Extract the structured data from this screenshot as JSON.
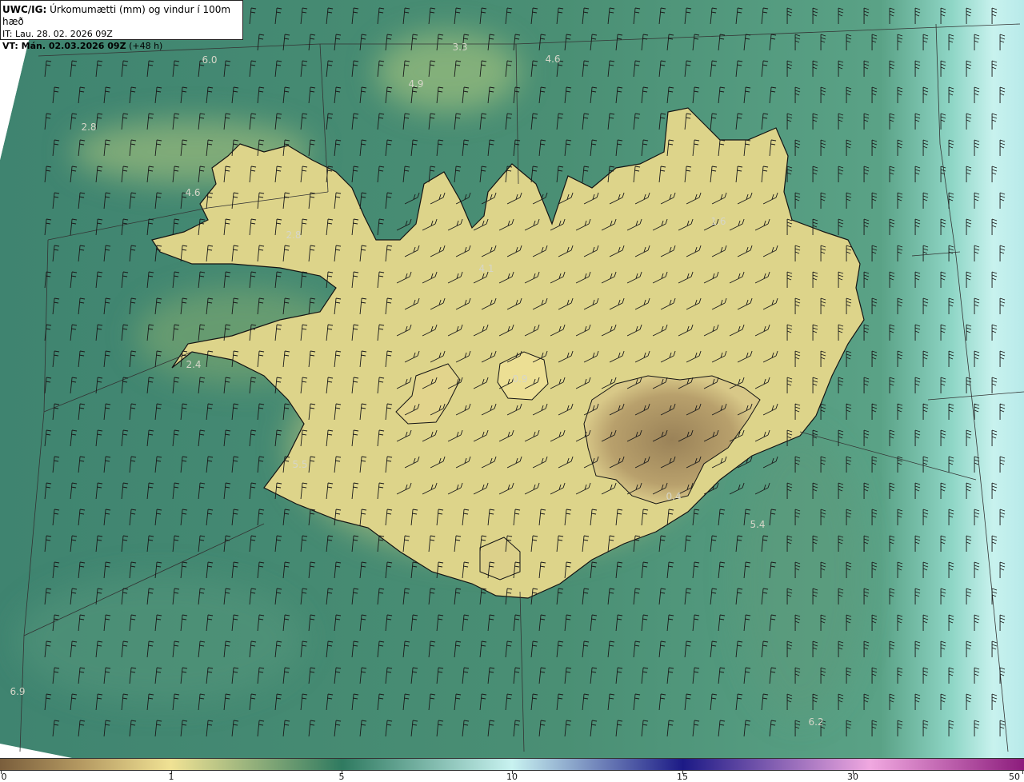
{
  "header": {
    "model": "UWC/IG:",
    "title": "Úrkomumætti (mm) og vindur í 100m hæð",
    "init_time": "IT: Lau. 28. 02. 2026 09Z",
    "valid_prefix": "VT: Mán. 02.03.2026 09Z",
    "valid_suffix": "(+48 h)"
  },
  "map_labels": [
    "6.0",
    "3.3",
    "4.6",
    "4.9",
    "2.8",
    "4.6",
    "2.8",
    "1.6",
    "4.1",
    "2.4",
    "0.9",
    "5.5",
    "0.4",
    "5.4",
    "6.9",
    "6.2"
  ],
  "colorbar": {
    "ticks": [
      "0",
      "1",
      "5",
      "10",
      "15",
      "30",
      "50"
    ],
    "colors": [
      "#7a5e3c",
      "#b59a62",
      "#f0e294",
      "#2f7a60",
      "#c8f2f0",
      "#1c1a86",
      "#f0a8e0",
      "#8c1c7c"
    ]
  },
  "colors": {
    "sea_dark": "#3f8470",
    "land_light": "#e6dc8a",
    "coast": "#141414"
  }
}
